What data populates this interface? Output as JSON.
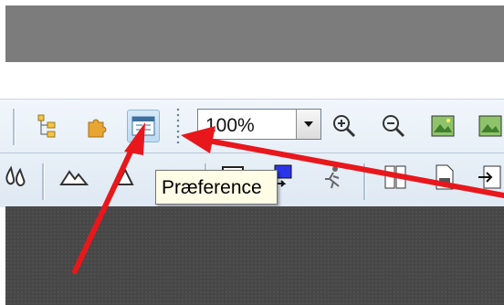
{
  "toolbar": {
    "zoom": {
      "value": "100%"
    },
    "tooltip": "Præference",
    "active_button": "preference-button"
  },
  "annotations": {
    "arrow_color": "#e8171c"
  }
}
